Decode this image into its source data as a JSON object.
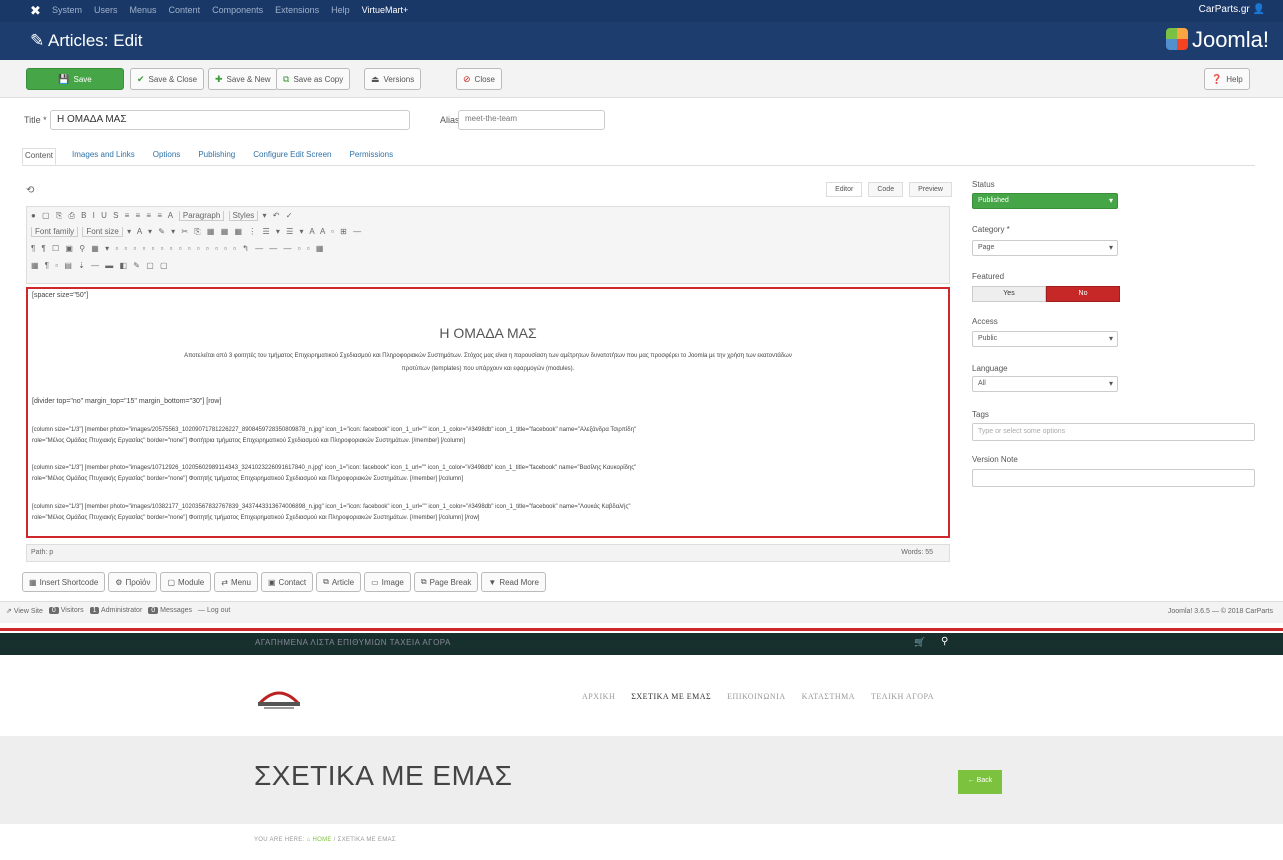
{
  "topnav": {
    "menu": [
      "System",
      "Users",
      "Menus",
      "Content",
      "Components",
      "Extensions",
      "Help"
    ],
    "virtuemart": "VirtueMart+",
    "user": "CarParts.gr"
  },
  "header": {
    "title": "Articles: Edit",
    "logo_text": "Joomla!"
  },
  "toolbar": {
    "save": "Save",
    "save_close": "Save & Close",
    "save_new": "Save & New",
    "save_copy": "Save as Copy",
    "versions": "Versions",
    "close": "Close",
    "help": "Help"
  },
  "form": {
    "title_label": "Title *",
    "title_value": "Η ΟΜΑΔΑ ΜΑΣ",
    "alias_label": "Alias",
    "alias_value": "meet-the-team"
  },
  "tabs": [
    "Content",
    "Images and Links",
    "Options",
    "Publishing",
    "Configure Edit Screen",
    "Permissions"
  ],
  "editor": {
    "tabs": [
      "Editor",
      "Code",
      "Preview"
    ],
    "format_select": "Paragraph",
    "styles_select": "Styles",
    "fontfamily_select": "Font family",
    "fontsize_select": "Font size",
    "content": {
      "spacer": "[spacer size=\"50\"]",
      "heading": "Η ΟΜΑΔΑ ΜΑΣ",
      "para1": "Αποτελείται από 3 φοιτητές του τμήματος Επιχειρηματικού Σχεδιασμού και Πληροφοριακών Συστημάτων. Στόχος μας είναι η παρουσίαση των αμέτρητων δυνατοτήτων που μας προσφέρει το Joomla με την χρήση των εκατοντάδων",
      "para2": "προτύπων (templates) που υπάρχουν και εφαρμογών (modules).",
      "divider": "[divider top=\"no\" margin_top=\"15\" margin_bottom=\"30\"] [row]",
      "col1a": "[column size=\"1/3\"] [member photo=\"images/20575563_10209071781226227_8908459728350809878_n.jpg\" icon_1=\"icon: facebook\" icon_1_url=\"\" icon_1_color=\"#3498db\" icon_1_title=\"facebook\" name=\"Αλεξάνδρα Τσιρπίδη\"",
      "col1b": "role=\"Μέλος Ομάδας Πτυχιακής Εργασίας\" border=\"none\"] Φοιτήτρια τμήματος Επιχειρηματικού Σχεδιασμού και Πληροφοριακών Συστημάτων. [/member] [/column]",
      "col2a": "[column size=\"1/3\"] [member photo=\"images/10712926_10205602989114343_3241023226091617840_n.jpg\" icon_1=\"icon: facebook\" icon_1_url=\"\" icon_1_color=\"#3498db\" icon_1_title=\"facebook\" name=\"Βασίλης Καυκορίδης\"",
      "col2b": "role=\"Μέλος Ομάδας Πτυχιακής Εργασίας\" border=\"none\"] Φοιτητής τμήματος Επιχειρηματικού Σχεδιασμού και Πληροφοριακών Συστημάτων. [/member] [/column]",
      "col3a": "[column size=\"1/3\"] [member photo=\"images/10382177_10203567832767839_3437443313674006898_n.jpg\" icon_1=\"icon: facebook\" icon_1_url=\"\" icon_1_color=\"#3498db\" icon_1_title=\"facebook\" name=\"Λουκάς Καβδαλής\"",
      "col3b": "role=\"Μέλος Ομάδας Πτυχιακής Εργασίας\" border=\"none\"] Φοιτητής τμήματος Επιχειρηματικού Σχεδιασμού και Πληροφοριακών Συστημάτων. [/member] [/column] [/row]"
    },
    "path": "Path: p",
    "words": "Words: 55"
  },
  "side": {
    "status_label": "Status",
    "status_value": "Published",
    "category_label": "Category *",
    "category_value": "Page",
    "featured_label": "Featured",
    "featured_yes": "Yes",
    "featured_no": "No",
    "access_label": "Access",
    "access_value": "Public",
    "language_label": "Language",
    "language_value": "All",
    "tags_label": "Tags",
    "tags_placeholder": "Type or select some options",
    "version_label": "Version Note"
  },
  "editor_buttons": [
    "Insert Shortcode",
    "Πρoϊόν",
    "Module",
    "Menu",
    "Contact",
    "Article",
    "Image",
    "Page Break",
    "Read More"
  ],
  "statusbar": {
    "view_site": "View Site",
    "visitors": "Visitors",
    "administrator": "Administrator",
    "messages": "Messages",
    "logout": "Log out",
    "version": "Joomla! 3.6.5 — © 2018 CarParts"
  },
  "site": {
    "top_links": "ΑΓΑΠΗΜΕΝΑ   ΛΙΣΤΑ ΕΠΙΘΥΜΙΩΝ   ΤΑΧΕΙΑ ΑΓΟΡΑ",
    "nav": [
      "ΑΡΧΙΚΗ",
      "ΣΧΕΤΙΚΑ ΜΕ ΕΜΑΣ",
      "ΕΠΙΚΟΙΝΩΝΙΑ",
      "ΚΑΤΑΣΤΗΜΑ",
      "ΤΕΛΙΚΗ ΑΓΟΡΑ"
    ],
    "hero_title": "ΣΧΕΤΙΚΑ ΜΕ ΕΜΑΣ",
    "back": "← Back",
    "crumb_prefix": "YOU ARE HERE:",
    "crumb_home": "HOME",
    "crumb_sep": "/",
    "crumb_current": "ΣΧΕΤΙΚΑ ΜΕ ΕΜΑΣ"
  },
  "colors": {
    "admin_navy": "#1a3867",
    "save_green": "#46a546",
    "close_red": "#c52827",
    "highlight_red": "#d0272d",
    "site_green": "#7dc23e"
  }
}
